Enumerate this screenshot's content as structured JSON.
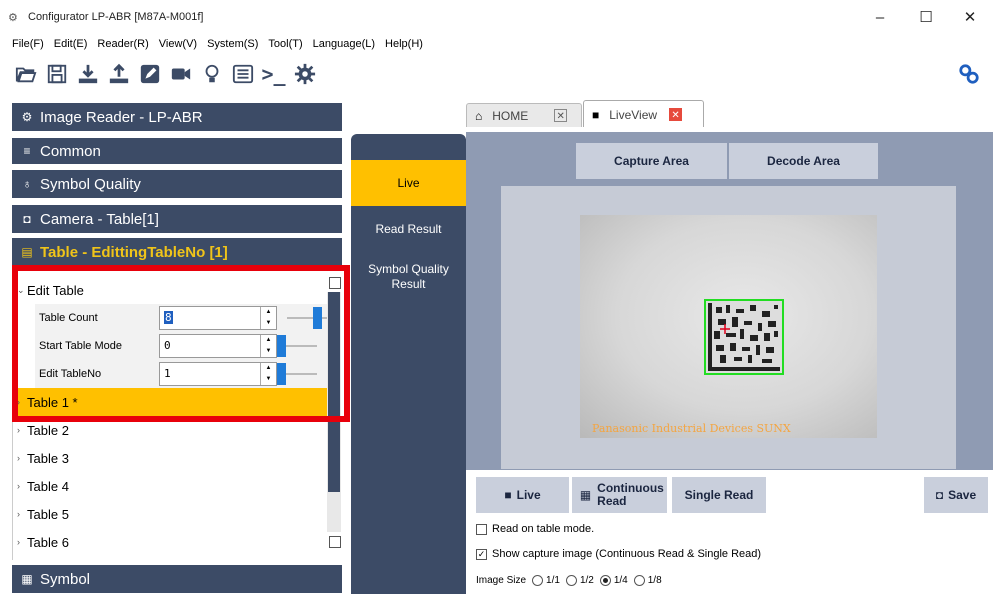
{
  "window": {
    "title": "Configurator LP-ABR [M87A-M001f]",
    "minimize": "–",
    "maximize": "☐",
    "close": "✕"
  },
  "menu": [
    "File(F)",
    "Edit(E)",
    "Reader(R)",
    "View(V)",
    "System(S)",
    "Tool(T)",
    "Language(L)",
    "Help(H)"
  ],
  "toolbar": {
    "icons": [
      "open-folder-icon",
      "save-icon",
      "download-icon",
      "upload-icon",
      "edit-icon",
      "camera-icon",
      "bulb-icon",
      "list-icon",
      "terminal-icon",
      "gear-icon"
    ],
    "terminal_label": ">_",
    "link_icon": "link-icon"
  },
  "left": {
    "sections": [
      {
        "label": "Image Reader - LP-ABR",
        "icon": "⚙"
      },
      {
        "label": "Common",
        "icon": "≡"
      },
      {
        "label": "Symbol Quality",
        "icon": "♁"
      },
      {
        "label": "Camera - Table[1]",
        "icon": "◘"
      },
      {
        "label": "Table - EdittingTableNo [1]",
        "icon": "▤"
      },
      {
        "label": "Symbol",
        "icon": "▦"
      }
    ],
    "tree": {
      "edit_table": "Edit Table",
      "props": [
        {
          "label": "Table Count",
          "value": "8",
          "slider": 1.0
        },
        {
          "label": "Start Table Mode",
          "value": "0",
          "slider": 0.0
        },
        {
          "label": "Edit TableNo",
          "value": "1",
          "slider": 0.0
        }
      ],
      "tables": [
        "Table 1 *",
        "Table 2",
        "Table 3",
        "Table 4",
        "Table 5",
        "Table 6"
      ]
    }
  },
  "nav": {
    "items": [
      "Live",
      "Read Result",
      "Symbol Quality Result"
    ]
  },
  "tabs": [
    {
      "label": "HOME",
      "icon": "⌂"
    },
    {
      "label": "LiveView",
      "icon": "■"
    }
  ],
  "right": {
    "capture_area": "Capture Area",
    "decode_area": "Decode Area",
    "brand_text": "Panasonic Industrial Devices SUNX",
    "live_btn": "Live",
    "continuous_btn": "Continuous Read",
    "single_btn": "Single Read",
    "save_btn": "Save",
    "read_on_table": "Read on table mode.",
    "show_capture": "Show capture image (Continuous Read & Single Read)",
    "image_size_label": "Image Size",
    "image_sizes": [
      "1/1",
      "1/2",
      "1/4",
      "1/8"
    ],
    "image_size_selected": "1/4",
    "read_on_table_checked": false,
    "show_capture_checked": true
  }
}
